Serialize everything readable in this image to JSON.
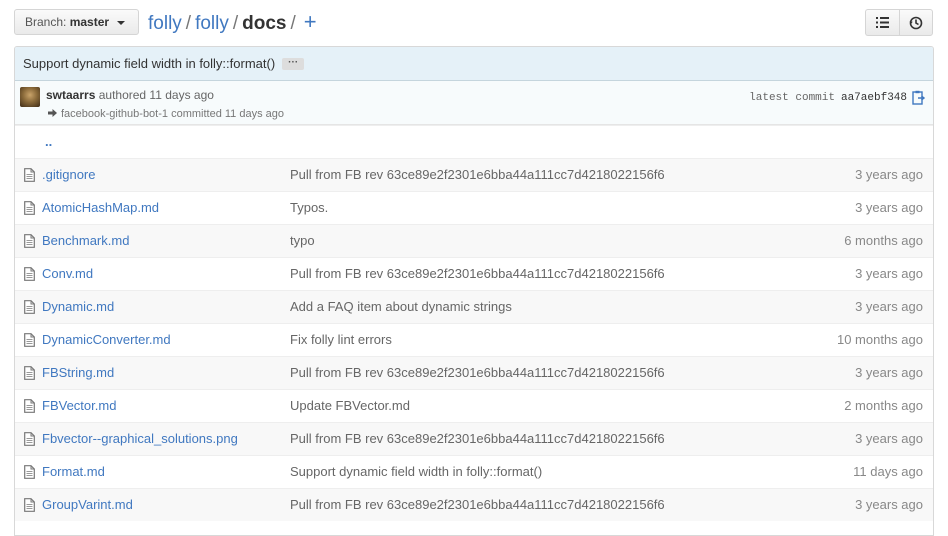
{
  "branch": {
    "prefix": "Branch:",
    "name": "master"
  },
  "breadcrumb": {
    "repo": "folly",
    "sep1": "/",
    "folder": "folly",
    "sep2": "/",
    "current": "docs",
    "sep3": "/",
    "plus": "+"
  },
  "toolbar": {
    "list_icon": "list-icon",
    "history_icon": "history-icon"
  },
  "commit": {
    "message": "Support dynamic field width in folly::format()",
    "ellipsis": "···",
    "author": "swtaarrs",
    "authored_text": "authored 11 days ago",
    "committer_text": "facebook-github-bot-1 committed 11 days ago",
    "latest_label": "latest commit",
    "sha": "aa7aebf348"
  },
  "parent_dir": "..",
  "files": [
    {
      "name": ".gitignore",
      "message": "Pull from FB rev 63ce89e2f2301e6bba44a111cc7d4218022156f6",
      "age": "3 years ago"
    },
    {
      "name": "AtomicHashMap.md",
      "message": "Typos.",
      "age": "3 years ago"
    },
    {
      "name": "Benchmark.md",
      "message": "typo",
      "age": "6 months ago"
    },
    {
      "name": "Conv.md",
      "message": "Pull from FB rev 63ce89e2f2301e6bba44a111cc7d4218022156f6",
      "age": "3 years ago"
    },
    {
      "name": "Dynamic.md",
      "message": "Add a FAQ item about dynamic strings",
      "age": "3 years ago"
    },
    {
      "name": "DynamicConverter.md",
      "message": "Fix folly lint errors",
      "age": "10 months ago"
    },
    {
      "name": "FBString.md",
      "message": "Pull from FB rev 63ce89e2f2301e6bba44a111cc7d4218022156f6",
      "age": "3 years ago"
    },
    {
      "name": "FBVector.md",
      "message": "Update FBVector.md",
      "age": "2 months ago"
    },
    {
      "name": "Fbvector--graphical_solutions.png",
      "message": "Pull from FB rev 63ce89e2f2301e6bba44a111cc7d4218022156f6",
      "age": "3 years ago"
    },
    {
      "name": "Format.md",
      "message": "Support dynamic field width in folly::format()",
      "age": "11 days ago"
    },
    {
      "name": "GroupVarint.md",
      "message": "Pull from FB rev 63ce89e2f2301e6bba44a111cc7d4218022156f6",
      "age": "3 years ago"
    }
  ],
  "colors": {
    "link": "#4078c0",
    "commit_bar": "#e5f1f8",
    "meta_bar": "#f7fbfc"
  }
}
